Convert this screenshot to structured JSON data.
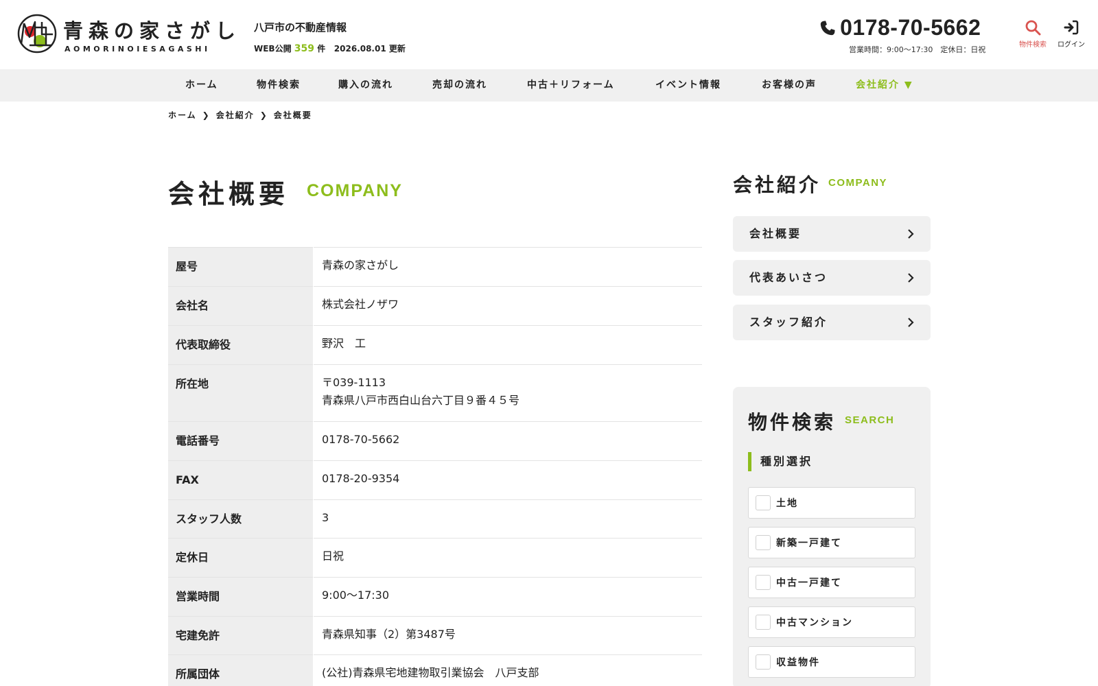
{
  "header": {
    "logo_jp": "青森の家さがし",
    "logo_en": "AOMORINOIESAGASHI",
    "tagline": "八戸市の不動産情報",
    "stock_prefix": "WEB公開",
    "stock_count": "359",
    "stock_suffix": "件",
    "update_date": "2026.08.01 更新",
    "phone": "0178-70-5662",
    "hours": "営業時間：9:00〜17:30　定休日：日祝",
    "search_label": "物件検索",
    "login_label": "ログイン",
    "colors": {
      "accent": "#8dbd1c",
      "search": "#d9534f"
    }
  },
  "nav": {
    "items": [
      {
        "label": "ホーム"
      },
      {
        "label": "物件検索"
      },
      {
        "label": "購入の流れ"
      },
      {
        "label": "売却の流れ"
      },
      {
        "label": "中古＋リフォーム"
      },
      {
        "label": "イベント情報"
      },
      {
        "label": "お客様の声"
      },
      {
        "label": "会社紹介 ▼"
      }
    ]
  },
  "breadcrumb": [
    "ホーム",
    "会社紹介",
    "会社概要"
  ],
  "page": {
    "title": "会社概要",
    "title_en": "COMPANY"
  },
  "company_table": [
    {
      "label": "屋号",
      "value": "青森の家さがし"
    },
    {
      "label": "会社名",
      "value": "株式会社ノザワ"
    },
    {
      "label": "代表取締役",
      "value": "野沢　工"
    },
    {
      "label": "所在地",
      "value": "〒039-1113",
      "value2": "青森県八戸市西白山台六丁目９番４５号"
    },
    {
      "label": "電話番号",
      "value": "0178-70-5662"
    },
    {
      "label": "FAX",
      "value": "0178-20-9354"
    },
    {
      "label": "スタッフ人数",
      "value": "3"
    },
    {
      "label": "定休日",
      "value": "日祝"
    },
    {
      "label": "営業時間",
      "value": "9:00〜17:30"
    },
    {
      "label": "宅建免許",
      "value": "青森県知事（2）第3487号"
    },
    {
      "label": "所属団体",
      "value": "(公社)青森県宅地建物取引業協会　八戸支部"
    }
  ],
  "sidebar": {
    "title": "会社紹介",
    "title_en": "COMPANY",
    "links": [
      {
        "label": "会社概要"
      },
      {
        "label": "代表あいさつ"
      },
      {
        "label": "スタッフ紹介"
      }
    ],
    "search": {
      "title": "物件検索",
      "title_en": "SEARCH",
      "kind_heading": "種別選択",
      "kinds": [
        {
          "label": "土地"
        },
        {
          "label": "新築一戸建て"
        },
        {
          "label": "中古一戸建て"
        },
        {
          "label": "中古マンション"
        },
        {
          "label": "収益物件"
        }
      ]
    }
  }
}
